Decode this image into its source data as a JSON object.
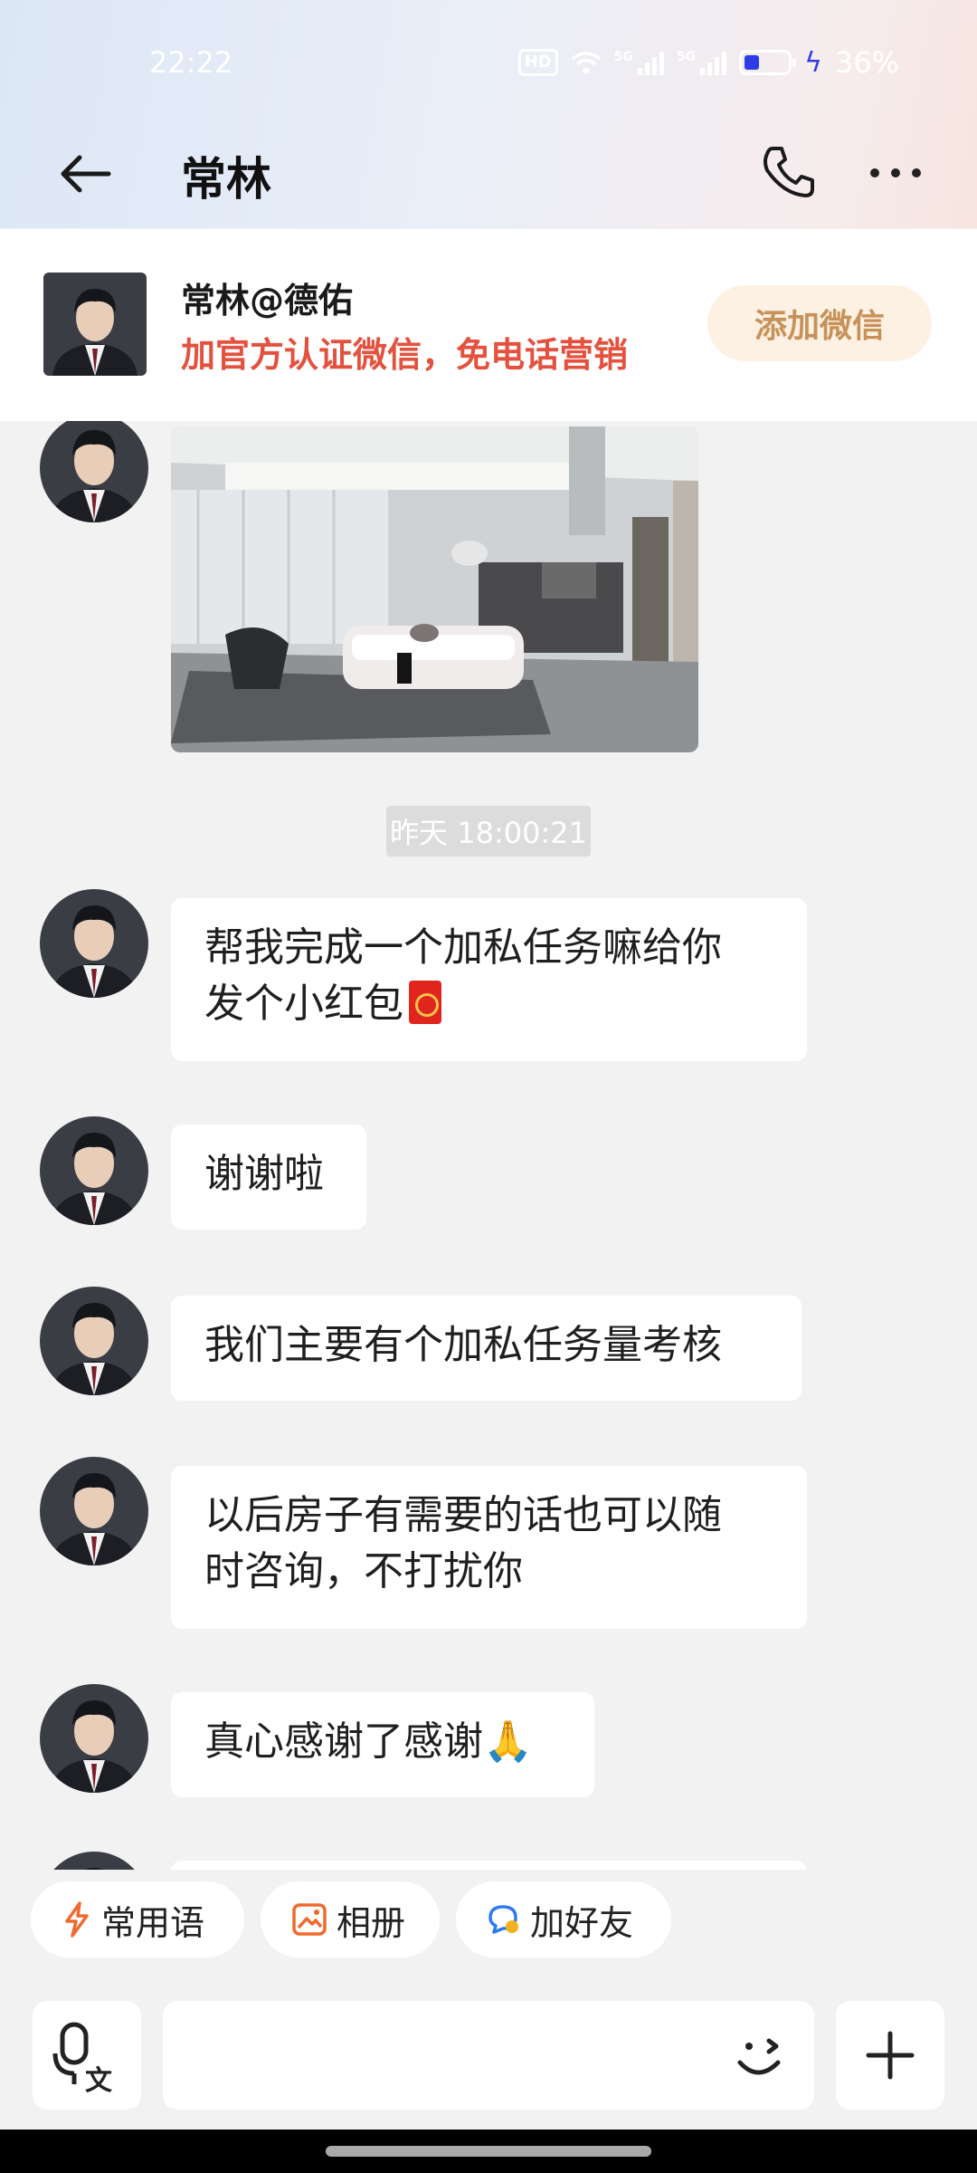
{
  "status_bar": {
    "time": "22:22",
    "hd_label": "HD",
    "sim1_label": "5G",
    "sim2_label": "5G",
    "battery_percent": "36%"
  },
  "header": {
    "title": "常林",
    "icons": [
      "back-arrow-icon",
      "phone-icon",
      "more-icon"
    ]
  },
  "agent_card": {
    "name": "常林@德佑",
    "subtitle": "加官方认证微信，免电话营销",
    "button_label": "添加微信",
    "button_color": "#c7925a"
  },
  "chat": {
    "timestamp": "昨天 18:00:21",
    "messages": [
      {
        "type": "image",
        "content": "living-room-photo"
      },
      {
        "type": "text",
        "line1": "帮我完成一个加私任务嘛给你",
        "line2": "发个小红包"
      },
      {
        "type": "text",
        "text": "谢谢啦"
      },
      {
        "type": "text",
        "text": "我们主要有个加私任务量考核"
      },
      {
        "type": "text",
        "line1": "以后房子有需要的话也可以随",
        "line2": "时咨询，不打扰你"
      },
      {
        "type": "text",
        "text": "真心感谢了感谢",
        "emoji": "🙏"
      }
    ]
  },
  "quick_actions": [
    {
      "label": "常用语",
      "icon": "lightning-icon"
    },
    {
      "label": "相册",
      "icon": "album-icon"
    },
    {
      "label": "加好友",
      "icon": "add-friend-icon"
    }
  ],
  "input_bar": {
    "placeholder": "",
    "voice_icon": "voice-to-text-icon",
    "emoji_icon": "smiley-icon",
    "plus_icon": "plus-icon"
  },
  "colors": {
    "accent_red": "#e4513e",
    "accent_orange": "#f06a2e",
    "bubble_bg": "#ffffff",
    "chat_bg": "#f2f2f3"
  }
}
